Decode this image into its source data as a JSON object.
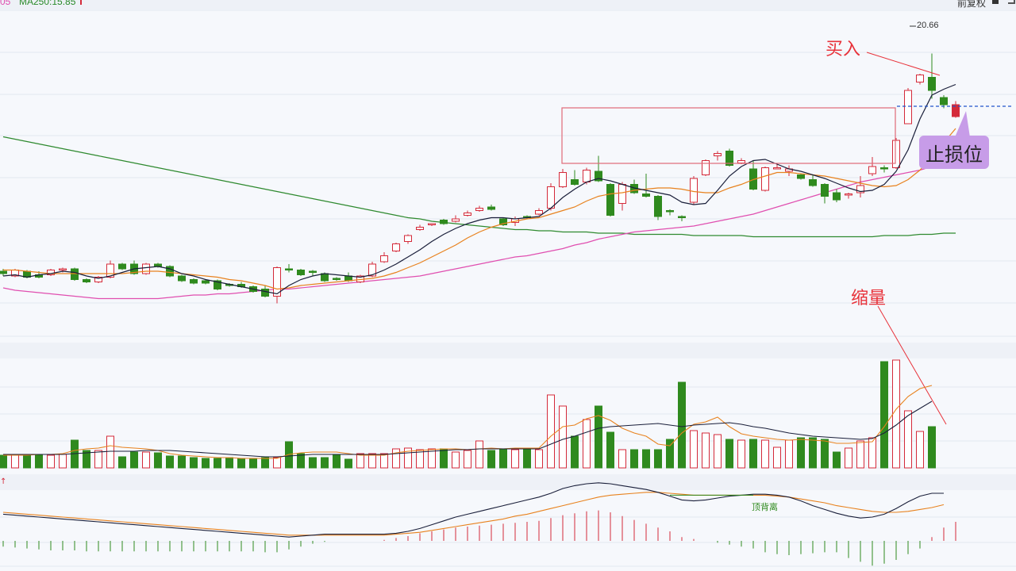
{
  "header": {
    "ma_prefix": "05",
    "ma250_label": "MA250:15.85",
    "fuquan_label": "前复权"
  },
  "annotations": {
    "buy": "买入",
    "stop_loss": "止损位",
    "shrink_volume": "缩量",
    "high_label": "20.66",
    "top_divergence": "顶背离"
  },
  "colors": {
    "up": "#d42a3a",
    "down": "#2f8a1e",
    "ma5": "#1a1f3a",
    "ma10": "#e8821e",
    "ma60": "#e04fb0",
    "ma250": "#2f8a2f",
    "annotation": "#e8323a",
    "stop_line": "#2255cc",
    "box": "#e06a78",
    "stop_bg": "#c79ce8"
  },
  "chart_data": [
    {
      "type": "candlestick",
      "title": "",
      "high_marker": 20.66,
      "candles": [
        [
          "d",
          0,
          2,
          -2,
          4
        ],
        [
          "u",
          -2,
          3,
          -3,
          4
        ],
        [
          "d",
          2,
          -3,
          -4,
          3
        ],
        [
          "d",
          -3,
          -1,
          -4,
          2
        ],
        [
          "u",
          -1,
          3,
          -2,
          4
        ],
        [
          "u",
          3,
          4,
          1,
          5
        ],
        [
          "d",
          4,
          -5,
          -6,
          5
        ],
        [
          "d",
          -5,
          -7,
          -8,
          -4
        ],
        [
          "u",
          -7,
          -3,
          -8,
          -2
        ],
        [
          "u",
          -3,
          8,
          -4,
          11
        ],
        [
          "d",
          8,
          4,
          3,
          9
        ],
        [
          "d",
          8,
          0,
          -1,
          11
        ],
        [
          "u",
          0,
          8,
          -1,
          9
        ],
        [
          "d",
          8,
          6,
          5,
          9
        ],
        [
          "d",
          6,
          -2,
          -3,
          7
        ],
        [
          "d",
          -2,
          -6,
          -7,
          -1
        ],
        [
          "d",
          -5,
          -8,
          -9,
          -4
        ],
        [
          "d",
          -6,
          -8,
          -9,
          -5
        ],
        [
          "d",
          -6,
          -13,
          -14,
          -5
        ],
        [
          "d",
          -9,
          -10,
          -11,
          -8
        ],
        [
          "d",
          -9,
          -11,
          -12,
          -7
        ],
        [
          "d",
          -11,
          -15,
          -16,
          -10
        ],
        [
          "d",
          -13,
          -19,
          -20,
          -10
        ],
        [
          "u",
          -19,
          5,
          -25,
          6
        ],
        [
          "d",
          4,
          3,
          1,
          8
        ],
        [
          "d",
          3,
          -1,
          -2,
          4
        ],
        [
          "d",
          2,
          1,
          -2,
          3
        ],
        [
          "d",
          0,
          -6,
          -7,
          1
        ],
        [
          "d",
          -4,
          -5,
          -6,
          -3
        ],
        [
          "d",
          -2,
          -6,
          -7,
          1
        ],
        [
          "u",
          -7,
          -2,
          -8,
          -1
        ],
        [
          "u",
          -2,
          8,
          -3,
          10
        ],
        [
          "u",
          10,
          15,
          9,
          18
        ],
        [
          "u",
          19,
          25,
          18,
          26
        ],
        [
          "u",
          27,
          32,
          25,
          33
        ],
        [
          "u",
          37,
          39,
          36,
          41
        ],
        [
          "u",
          41,
          42,
          40,
          42
        ],
        [
          "d",
          45,
          42,
          41,
          46
        ],
        [
          "u",
          44,
          46,
          43,
          49
        ],
        [
          "u",
          49,
          51,
          48,
          53
        ],
        [
          "u",
          53,
          55,
          52,
          57
        ],
        [
          "d",
          56,
          54,
          53,
          58
        ],
        [
          "d",
          46,
          41,
          40,
          47
        ],
        [
          "u",
          43,
          46,
          40,
          48
        ],
        [
          "d",
          48,
          47,
          46,
          49
        ],
        [
          "u",
          50,
          53,
          49,
          55
        ],
        [
          "u",
          55,
          73,
          53,
          76
        ],
        [
          "u",
          73,
          85,
          72,
          88
        ],
        [
          "d",
          79,
          75,
          74,
          87
        ],
        [
          "u",
          77,
          87,
          75,
          89
        ],
        [
          "d",
          86,
          78,
          77,
          99
        ],
        [
          "d",
          75,
          49,
          48,
          76
        ],
        [
          "u",
          59,
          75,
          53,
          77
        ],
        [
          "d",
          75,
          68,
          67,
          79
        ],
        [
          "d",
          67,
          65,
          64,
          84
        ],
        [
          "d",
          65,
          48,
          45,
          66
        ],
        [
          "d",
          53,
          52,
          49,
          54
        ],
        [
          "d",
          48,
          47,
          44,
          49
        ],
        [
          "u",
          60,
          80,
          58,
          82
        ],
        [
          "u",
          83,
          95,
          82,
          96
        ],
        [
          "u",
          99,
          101,
          95,
          103
        ],
        [
          "d",
          103,
          91,
          90,
          105
        ],
        [
          "u",
          93,
          95,
          92,
          97
        ],
        [
          "d",
          88,
          71,
          70,
          95
        ],
        [
          "u",
          70,
          89,
          69,
          90
        ],
        [
          "u",
          88,
          89,
          88,
          93
        ],
        [
          "u",
          86,
          88,
          82,
          91
        ],
        [
          "d",
          83,
          80,
          79,
          84
        ],
        [
          "d",
          79,
          74,
          73,
          83
        ],
        [
          "d",
          75,
          65,
          59,
          76
        ],
        [
          "d",
          68,
          62,
          60,
          71
        ],
        [
          "u",
          66,
          67,
          63,
          68
        ],
        [
          "u",
          68,
          74,
          64,
          82
        ],
        [
          "u",
          84,
          90,
          82,
          98
        ],
        [
          "d",
          89,
          88,
          85,
          91
        ],
        [
          "u",
          89,
          112,
          88,
          114
        ],
        [
          "u",
          126,
          154,
          126,
          156
        ],
        [
          "u",
          161,
          167,
          159,
          168
        ],
        [
          "d",
          165,
          154,
          147,
          185
        ],
        [
          "d",
          148,
          142,
          139,
          150
        ],
        [
          "u",
          132,
          142,
          131,
          145
        ]
      ],
      "y_note": "candle values are price offsets (open,close,low,high) relative to chart baseline",
      "ma5": [
        -2,
        -1,
        -3,
        -1,
        0,
        2,
        1,
        -2,
        -4,
        -2,
        1,
        4,
        5,
        6,
        4,
        0,
        -2,
        -5,
        -7,
        -9,
        -11,
        -13,
        -15,
        -17,
        -10,
        -5,
        -2,
        0,
        -1,
        -2,
        -3,
        -1,
        3,
        8,
        14,
        20,
        27,
        33,
        38,
        42,
        45,
        47,
        47,
        46,
        47,
        48,
        55,
        64,
        71,
        77,
        80,
        78,
        75,
        72,
        70,
        68,
        66,
        60,
        58,
        59,
        70,
        82,
        90,
        95,
        96,
        92,
        88,
        86,
        83,
        80,
        76,
        72,
        69,
        70,
        75,
        86,
        104,
        130,
        150,
        155,
        159
      ],
      "ma10": [
        3,
        3,
        2,
        1,
        0,
        0,
        0,
        0,
        0,
        0,
        0,
        1,
        2,
        2,
        1,
        0,
        -1,
        -2,
        -3,
        -5,
        -6,
        -8,
        -10,
        -13,
        -12,
        -10,
        -9,
        -8,
        -7,
        -6,
        -5,
        -4,
        -2,
        1,
        5,
        9,
        14,
        19,
        24,
        30,
        35,
        39,
        42,
        44,
        46,
        47,
        50,
        53,
        56,
        61,
        65,
        67,
        68,
        70,
        71,
        72,
        72,
        71,
        69,
        68,
        68,
        72,
        75,
        79,
        82,
        85,
        85,
        84,
        83,
        82,
        80,
        78,
        76,
        74,
        73,
        74,
        79,
        87,
        98,
        110,
        122
      ],
      "ma60": [
        -12,
        -14,
        -15,
        -16,
        -17,
        -18,
        -19,
        -20,
        -21,
        -21,
        -21,
        -21,
        -21,
        -21,
        -20,
        -19,
        -18,
        -18,
        -17,
        -17,
        -16,
        -15,
        -14,
        -13,
        -13,
        -12,
        -11,
        -10,
        -9,
        -8,
        -7,
        -6,
        -5,
        -4,
        -3,
        -2,
        0,
        2,
        4,
        6,
        8,
        10,
        12,
        14,
        15,
        17,
        19,
        21,
        24,
        26,
        29,
        31,
        33,
        35,
        36,
        37,
        38,
        39,
        40,
        42,
        44,
        46,
        48,
        50,
        53,
        56,
        59,
        62,
        65,
        68,
        71,
        74,
        77,
        79,
        81,
        83,
        85,
        87,
        90,
        94,
        98
      ],
      "ma250": [
        115,
        113,
        111,
        109,
        107,
        105,
        103,
        101,
        99,
        97,
        95,
        93,
        91,
        89,
        87,
        85,
        83,
        81,
        79,
        77,
        75,
        73,
        71,
        69,
        67,
        65,
        63,
        61,
        59,
        57,
        55,
        53,
        51,
        49,
        47,
        46,
        44,
        43,
        42,
        41,
        40,
        39,
        38,
        37,
        37,
        36,
        36,
        35,
        35,
        35,
        34,
        34,
        34,
        33,
        33,
        33,
        33,
        33,
        32,
        32,
        32,
        32,
        32,
        31,
        31,
        31,
        31,
        31,
        31,
        31,
        31,
        31,
        31,
        31,
        32,
        32,
        32,
        33,
        33,
        34,
        34
      ],
      "volume": [
        16,
        16,
        16,
        16,
        16,
        17,
        35,
        22,
        22,
        40,
        14,
        20,
        20,
        19,
        15,
        15,
        13,
        12,
        12,
        13,
        12,
        11,
        13,
        13,
        33,
        18,
        13,
        13,
        17,
        11,
        18,
        18,
        18,
        24,
        25,
        23,
        24,
        24,
        20,
        22,
        34,
        22,
        23,
        23,
        23,
        23,
        92,
        78,
        40,
        61,
        78,
        45,
        23,
        23,
        23,
        23,
        36,
        108,
        47,
        44,
        42,
        36,
        35,
        36,
        35,
        26,
        35,
        38,
        38,
        36,
        20,
        25,
        34,
        38,
        134,
        136,
        72,
        46,
        52
      ],
      "volume_ma5": [
        16,
        16,
        16,
        17,
        17,
        18,
        22,
        24,
        25,
        28,
        26,
        25,
        24,
        22,
        18,
        16,
        15,
        14,
        13,
        13,
        12,
        12,
        12,
        12,
        17,
        19,
        20,
        20,
        20,
        18,
        16,
        16,
        16,
        19,
        21,
        22,
        23,
        24,
        24,
        23,
        24,
        25,
        24,
        25,
        25,
        25,
        40,
        52,
        54,
        62,
        66,
        60,
        50,
        44,
        40,
        30,
        28,
        44,
        55,
        58,
        64,
        52,
        43,
        40,
        38,
        36,
        35,
        36,
        35,
        34,
        31,
        31,
        32,
        33,
        52,
        74,
        90,
        100,
        104
      ],
      "volume_ma10": [
        17,
        17,
        17,
        17,
        17,
        17,
        18,
        19,
        20,
        21,
        21,
        21,
        22,
        22,
        22,
        21,
        20,
        19,
        18,
        17,
        16,
        15,
        14,
        14,
        15,
        16,
        17,
        17,
        17,
        17,
        17,
        17,
        17,
        18,
        19,
        20,
        21,
        22,
        23,
        23,
        24,
        24,
        24,
        24,
        24,
        24,
        30,
        36,
        40,
        45,
        50,
        52,
        53,
        54,
        55,
        56,
        54,
        52,
        54,
        55,
        56,
        57,
        55,
        52,
        50,
        47,
        44,
        42,
        40,
        39,
        38,
        37,
        36,
        37,
        44,
        54,
        66,
        75,
        84
      ],
      "macd_hist": [
        -6,
        -7,
        -8,
        -9,
        -10,
        -10,
        -10,
        -11,
        -11,
        -11,
        -11,
        -11,
        -11,
        -11,
        -11,
        -11,
        -11,
        -11,
        -11,
        -11,
        -11,
        -11,
        -12,
        -12,
        -9,
        -6,
        -3,
        -1,
        0,
        0,
        0,
        0,
        1,
        3,
        5,
        8,
        10,
        12,
        14,
        15,
        16,
        17,
        18,
        19,
        20,
        21,
        24,
        27,
        29,
        31,
        32,
        30,
        26,
        22,
        18,
        14,
        10,
        4,
        2,
        0,
        -2,
        -4,
        -6,
        -8,
        -12,
        -14,
        -15,
        -14,
        -13,
        -12,
        -12,
        -18,
        -22,
        -26,
        -24,
        -20,
        -14,
        -8,
        4,
        14,
        20
      ],
      "macd_dif": [
        28,
        27,
        26,
        25,
        24,
        23,
        22,
        21,
        20,
        19,
        18,
        17,
        16,
        15,
        14,
        13,
        12,
        11,
        10,
        9,
        8,
        7,
        6,
        5,
        4,
        5,
        6,
        7,
        7,
        7,
        7,
        7,
        7,
        8,
        10,
        13,
        17,
        21,
        25,
        28,
        31,
        34,
        37,
        40,
        43,
        46,
        50,
        55,
        58,
        60,
        61,
        60,
        58,
        56,
        54,
        51,
        47,
        43,
        42,
        43,
        45,
        47,
        48,
        49,
        49,
        48,
        46,
        42,
        37,
        33,
        29,
        26,
        24,
        25,
        28,
        34,
        41,
        47,
        50,
        50
      ],
      "macd_dea": [
        30,
        29,
        28,
        27,
        26,
        25,
        24,
        23,
        22,
        21,
        20,
        19,
        18,
        17,
        16,
        15,
        14,
        13,
        12,
        11,
        10,
        9,
        8,
        7,
        6,
        6,
        6,
        6,
        6,
        6,
        6,
        6,
        6,
        7,
        8,
        9,
        11,
        13,
        15,
        17,
        19,
        21,
        23,
        26,
        28,
        31,
        34,
        37,
        40,
        43,
        46,
        48,
        49,
        50,
        51,
        51,
        50,
        49,
        48,
        48,
        48,
        48,
        48,
        48,
        48,
        47,
        46,
        44,
        42,
        40,
        37,
        35,
        33,
        31,
        30,
        30,
        31,
        33,
        35,
        38
      ]
    }
  ]
}
